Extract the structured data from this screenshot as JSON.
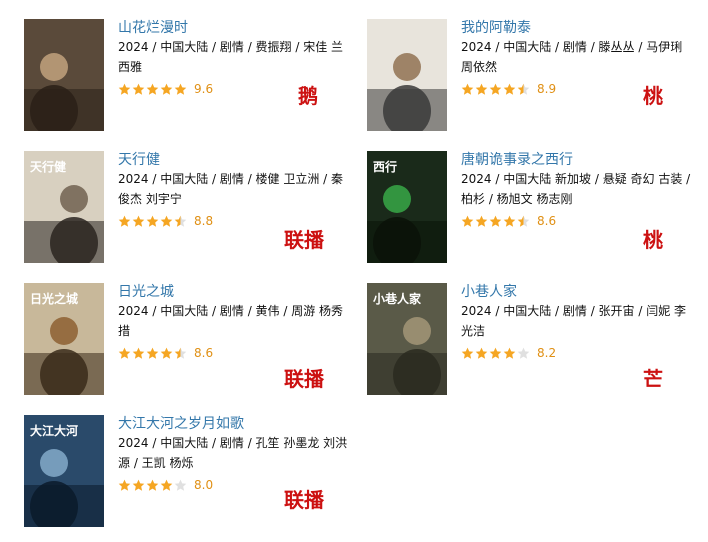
{
  "items": [
    {
      "title": "山花烂漫时",
      "meta": "2024 / 中国大陆 / 剧情 / 费振翔 / 宋佳 兰西雅",
      "score": "9.6",
      "stars": 5,
      "tag": "鹅",
      "poster": {
        "bg": "#5a4a3a",
        "accent": "#c8a882",
        "dark": "#2a2018",
        "label": ""
      }
    },
    {
      "title": "我的阿勒泰",
      "meta": "2024 / 中国大陆 / 剧情 / 滕丛丛 / 马伊琍 周依然",
      "score": "8.9",
      "stars": 4.5,
      "tag": "桃",
      "poster": {
        "bg": "#e8e4dc",
        "accent": "#8b6a4a",
        "dark": "#3a3a3a",
        "label": ""
      }
    },
    {
      "title": "天行健",
      "meta": "2024 / 中国大陆 / 剧情 / 楼健 卫立洲 / 秦俊杰 刘宇宁",
      "score": "8.8",
      "stars": 4.5,
      "tag": "联播",
      "poster": {
        "bg": "#d8d0c0",
        "accent": "#6a5a48",
        "dark": "#2a2420",
        "label": "天行健"
      }
    },
    {
      "title": "唐朝诡事录之西行",
      "meta": "2024 / 中国大陆 新加坡 / 悬疑 奇幻 古装 / 柏杉 / 杨旭文 杨志刚",
      "score": "8.6",
      "stars": 4.5,
      "tag": "桃",
      "poster": {
        "bg": "#1a2a1a",
        "accent": "#3ab04a",
        "dark": "#0a1208",
        "label": "西行"
      }
    },
    {
      "title": "日光之城",
      "meta": "2024 / 中国大陆 / 剧情 / 黄伟 / 周游 杨秀措",
      "score": "8.6",
      "stars": 4.5,
      "tag": "联播",
      "poster": {
        "bg": "#c8b89a",
        "accent": "#8a5a2a",
        "dark": "#3a2a1a",
        "label": "日光之城"
      }
    },
    {
      "title": "小巷人家",
      "meta": "2024 / 中国大陆 / 剧情 / 张开宙 / 闫妮 李光洁",
      "score": "8.2",
      "stars": 4,
      "tag": "芒",
      "poster": {
        "bg": "#5a5a48",
        "accent": "#a89a7a",
        "dark": "#2a2a20",
        "label": "小巷人家"
      }
    },
    {
      "title": "大江大河之岁月如歌",
      "meta": "2024 / 中国大陆 / 剧情 / 孔笙 孙墨龙 刘洪源 / 王凯 杨烁",
      "score": "8.0",
      "stars": 4,
      "tag": "联播",
      "poster": {
        "bg": "#2a4a6a",
        "accent": "#8ab0d0",
        "dark": "#0a1a2a",
        "label": "大江大河"
      }
    }
  ],
  "colors": {
    "star_filled": "#f5a623",
    "star_empty": "#e0e0e0",
    "title_link": "#3377aa",
    "tag_red": "#cc1111"
  }
}
